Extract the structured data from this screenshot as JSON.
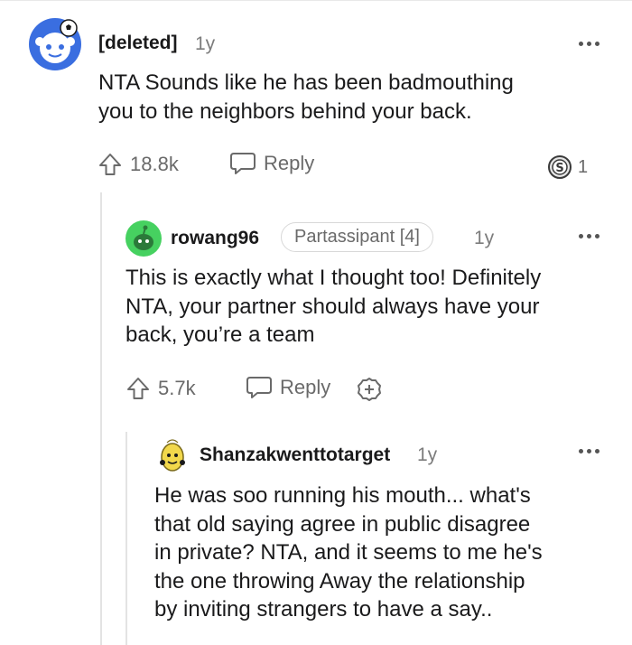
{
  "comments": [
    {
      "author": "[deleted]",
      "time": "1y",
      "body_lines": [
        "NTA Sounds like he has been badmouthing",
        "you to the neighbors behind your back."
      ],
      "upvotes": "18.8k",
      "reply_label": "Reply",
      "award_count": "1"
    },
    {
      "author": "rowang96",
      "flair": "Partassipant [4]",
      "time": "1y",
      "body_lines": [
        "This is exactly what I thought too! Definitely",
        "NTA, your partner should always have your",
        "back, you’re a team"
      ],
      "upvotes": "5.7k",
      "reply_label": "Reply"
    },
    {
      "author": "Shanzakwenttotarget",
      "time": "1y",
      "body_lines": [
        "He was soo running his mouth... what's",
        "that old saying agree in public disagree",
        "in private? NTA, and it seems to me he's",
        "the one throwing Away the relationship",
        "by inviting strangers to have a say.."
      ]
    }
  ],
  "icons": {
    "upvote": "arrow-up-outline-icon",
    "reply": "speech-bubble-icon",
    "award": "award-badge-icon",
    "add_award": "plus-badge-icon",
    "more": "more-dots-icon"
  },
  "colors": {
    "accent_green": "#46d160",
    "avatar_blue": "#3a6ee0",
    "thread_line": "#e3e3e3",
    "muted_text": "#7c7c7c"
  }
}
